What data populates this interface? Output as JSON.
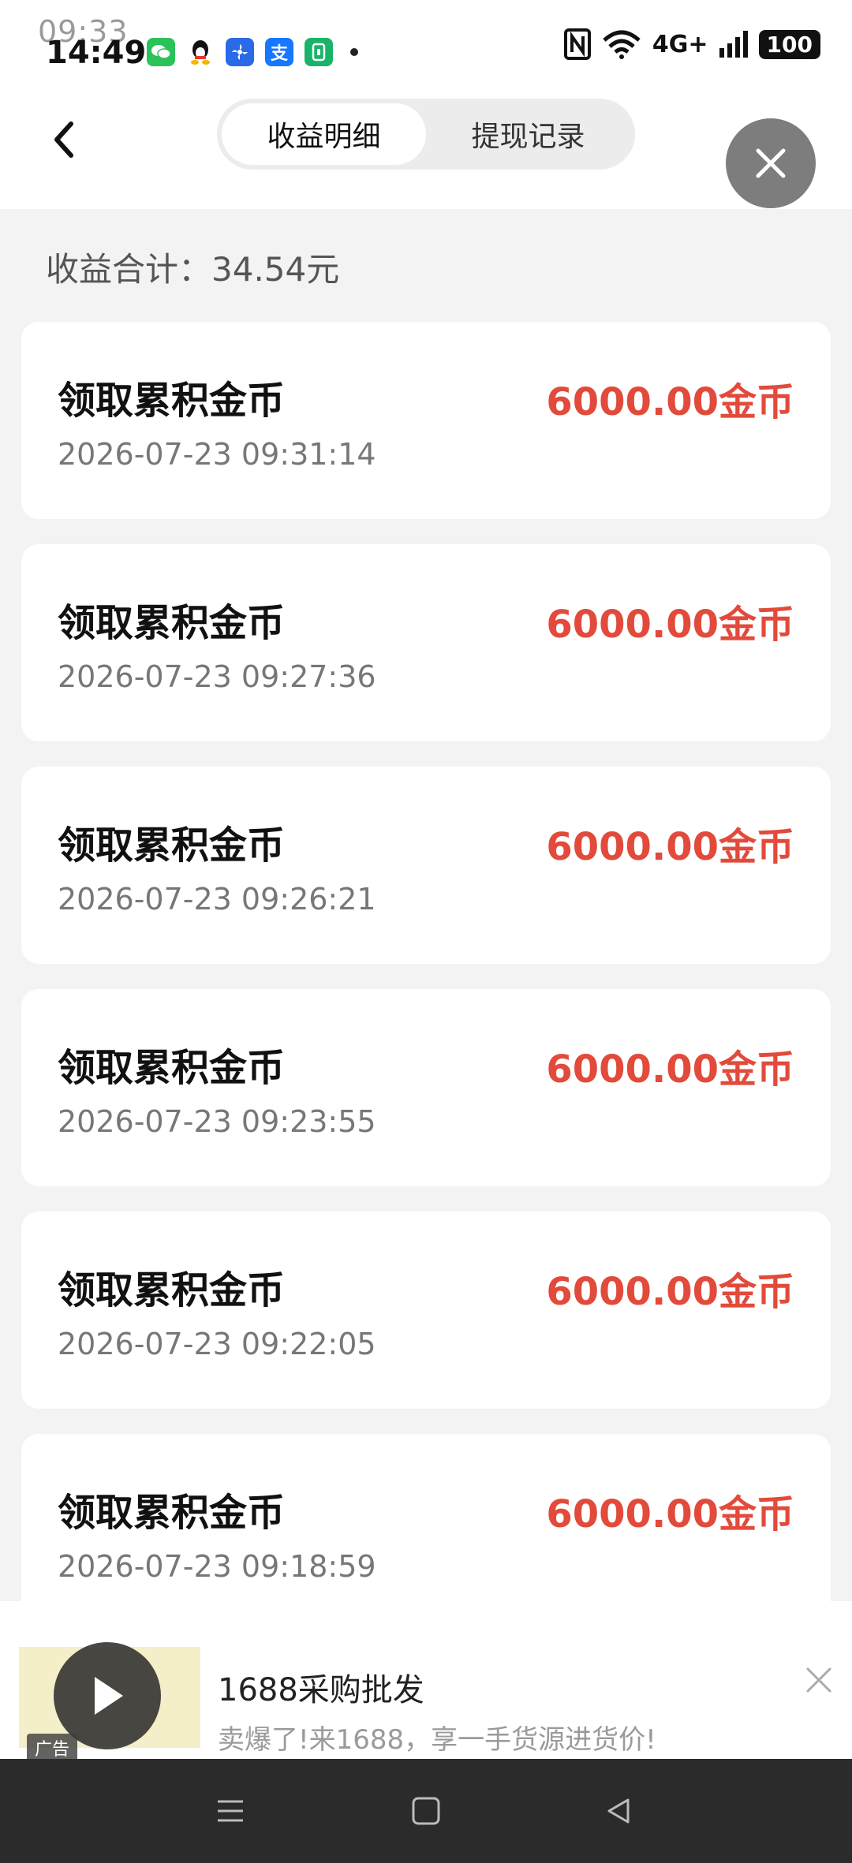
{
  "status_bar": {
    "ghost_time": "09:33",
    "time": "14:49",
    "network": "4G+",
    "battery": "100"
  },
  "header": {
    "back_icon": "chevron-left-icon",
    "tabs": [
      {
        "label": "收益明细",
        "active": true
      },
      {
        "label": "提现记录",
        "active": false
      }
    ],
    "close_icon": "close-icon"
  },
  "summary": {
    "total_text": "收益合计：34.54元"
  },
  "records": [
    {
      "title": "领取累积金币",
      "date": "2026-07-23 09:31:14",
      "amount": "6000.00金币"
    },
    {
      "title": "领取累积金币",
      "date": "2026-07-23 09:27:36",
      "amount": "6000.00金币"
    },
    {
      "title": "领取累积金币",
      "date": "2026-07-23 09:26:21",
      "amount": "6000.00金币"
    },
    {
      "title": "领取累积金币",
      "date": "2026-07-23 09:23:55",
      "amount": "6000.00金币"
    },
    {
      "title": "领取累积金币",
      "date": "2026-07-23 09:22:05",
      "amount": "6000.00金币"
    },
    {
      "title": "领取累积金币",
      "date": "2026-07-23 09:18:59",
      "amount": "6000.00金币"
    }
  ],
  "ad": {
    "badge": "广告",
    "title": "1688采购批发",
    "subtitle": "卖爆了!来1688，享一手货源进货价!"
  },
  "colors": {
    "amount": "#e24a3b",
    "background": "#f3f3f3",
    "navbar": "#2b2b2b"
  }
}
